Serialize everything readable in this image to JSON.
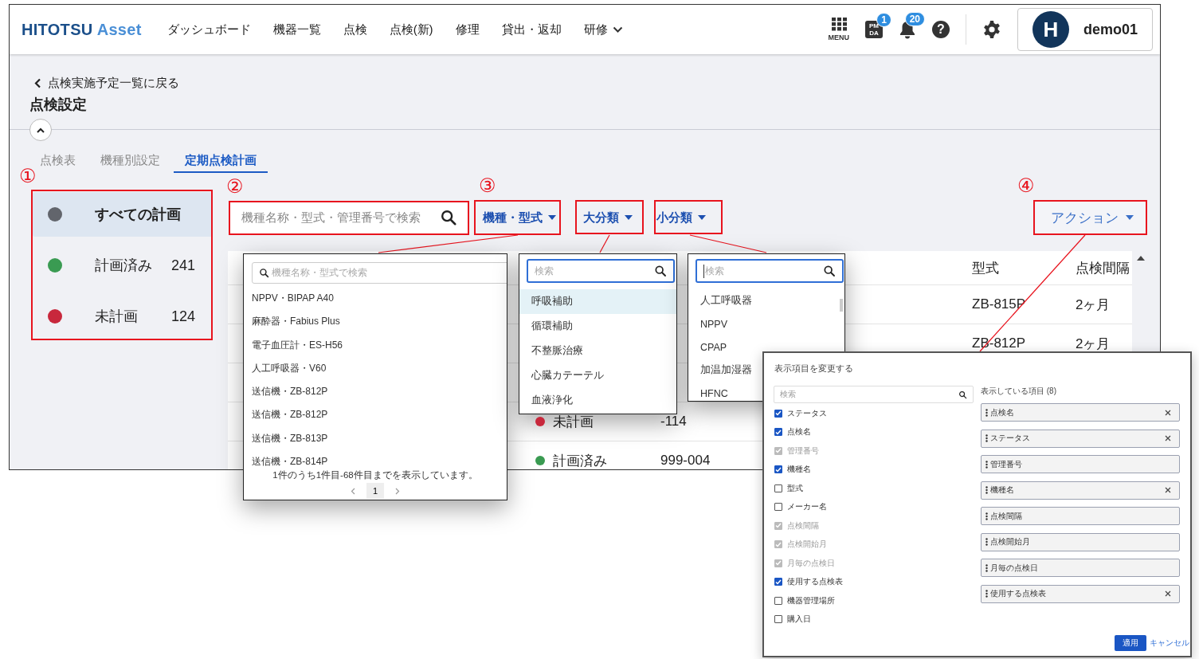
{
  "header": {
    "logo": {
      "main": "HITOTSU",
      "accent": "Asset"
    },
    "nav": [
      {
        "label": "ダッシュボード",
        "dropdown": false
      },
      {
        "label": "機器一覧",
        "dropdown": false
      },
      {
        "label": "点検",
        "dropdown": false
      },
      {
        "label": "点検(新)",
        "dropdown": false
      },
      {
        "label": "修理",
        "dropdown": false
      },
      {
        "label": "貸出・返却",
        "dropdown": false
      },
      {
        "label": "研修",
        "dropdown": true
      }
    ],
    "menu_label": "MENU",
    "app_icon_lines": [
      "PM",
      "DA"
    ],
    "app_badge": "1",
    "bell_badge": "20",
    "help_glyph": "?",
    "user": {
      "initial": "H",
      "name": "demo01"
    }
  },
  "back_link": "点検実施予定一覧に戻る",
  "page_title": "点検設定",
  "tabs": [
    {
      "label": "点検表",
      "selected": false
    },
    {
      "label": "機種別設定",
      "selected": false
    },
    {
      "label": "定期点検計画",
      "selected": true
    }
  ],
  "plan_filters": [
    {
      "label": "すべての計画",
      "color": "#62656c",
      "selected": true
    },
    {
      "label": "計画済み",
      "count": "241",
      "color": "#3a9b52",
      "selected": false
    },
    {
      "label": "未計画",
      "count": "124",
      "color": "#c8283c",
      "selected": false
    }
  ],
  "search": {
    "placeholder": "機種名称・型式・管理番号で検索"
  },
  "filter_buttons": [
    "機種・型式",
    "大分類",
    "小分類"
  ],
  "action_button": "アクション",
  "table": {
    "columns": [
      "型式",
      "点検間隔"
    ],
    "rows": [
      {
        "model": "ZB-815P",
        "interval": "2ヶ月"
      },
      {
        "model": "ZB-812P",
        "interval": "2ヶ月"
      },
      {
        "status": "未計画",
        "color": "#c8283c",
        "number": "-114"
      },
      {
        "status": "計画済み",
        "color": "#3a9b52",
        "number": "999-004"
      }
    ]
  },
  "model_dropdown": {
    "placeholder": "機種名称・型式で検索",
    "items": [
      "NPPV・BIPAP A40",
      "麻酔器・Fabius Plus",
      "電子血圧計・ES-H56",
      "人工呼吸器・V60",
      "送信機・ZB-812P",
      "送信機・ZB-812P",
      "送信機・ZB-813P",
      "送信機・ZB-814P"
    ],
    "summary": "1件のうち1件目-68件目までを表示しています。",
    "page": "1"
  },
  "category_dropdown": {
    "placeholder": "検索",
    "items": [
      {
        "label": "呼吸補助",
        "selected": true
      },
      {
        "label": "循環補助",
        "selected": false
      },
      {
        "label": "不整脈治療",
        "selected": false
      },
      {
        "label": "心臓カテーテル",
        "selected": false
      },
      {
        "label": "血液浄化",
        "selected": false
      }
    ]
  },
  "subcategory_dropdown": {
    "placeholder": "検索",
    "items": [
      "人工呼吸器",
      "NPPV",
      "CPAP",
      "加温加湿器",
      "HFNC"
    ]
  },
  "column_dialog": {
    "title": "表示項目を変更する",
    "search_placeholder": "検索",
    "options": [
      {
        "label": "ステータス",
        "checked": true,
        "disabled": false
      },
      {
        "label": "点検名",
        "checked": true,
        "disabled": false
      },
      {
        "label": "管理番号",
        "checked": true,
        "disabled": true
      },
      {
        "label": "機種名",
        "checked": true,
        "disabled": false
      },
      {
        "label": "型式",
        "checked": false,
        "disabled": false
      },
      {
        "label": "メーカー名",
        "checked": false,
        "disabled": false
      },
      {
        "label": "点検間隔",
        "checked": true,
        "disabled": true
      },
      {
        "label": "点検開始月",
        "checked": true,
        "disabled": true
      },
      {
        "label": "月毎の点検日",
        "checked": true,
        "disabled": true
      },
      {
        "label": "使用する点検表",
        "checked": true,
        "disabled": false
      },
      {
        "label": "機器管理場所",
        "checked": false,
        "disabled": false
      },
      {
        "label": "購入日",
        "checked": false,
        "disabled": false
      }
    ],
    "shown_heading": "表示している項目 (8)",
    "shown_items": [
      {
        "label": "点検名",
        "removable": true
      },
      {
        "label": "ステータス",
        "removable": true
      },
      {
        "label": "管理番号",
        "removable": false
      },
      {
        "label": "機種名",
        "removable": true
      },
      {
        "label": "点検間隔",
        "removable": false
      },
      {
        "label": "点検開始月",
        "removable": false
      },
      {
        "label": "月毎の点検日",
        "removable": false
      },
      {
        "label": "使用する点検表",
        "removable": true
      }
    ],
    "apply": "適用",
    "cancel": "キャンセル"
  },
  "annotations": [
    "①",
    "②",
    "③",
    "④"
  ]
}
